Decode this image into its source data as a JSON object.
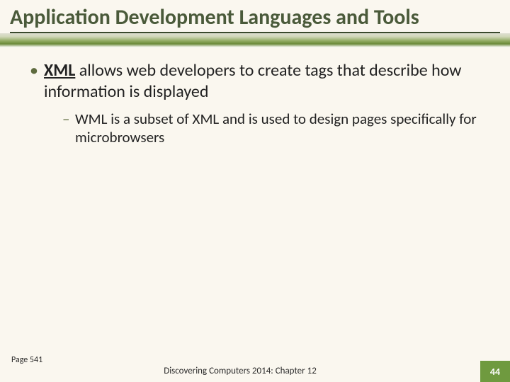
{
  "title": "Application Development Languages and Tools",
  "bullet1": {
    "strong": "XML",
    "rest": " allows web developers to create tags that describe how information is displayed"
  },
  "bullet2": "WML is a subset of XML and is used to design pages specifically for microbrowsers",
  "footer": {
    "page_ref": "Page 541",
    "center": "Discovering Computers 2014: Chapter 12",
    "slide_number": "44"
  }
}
